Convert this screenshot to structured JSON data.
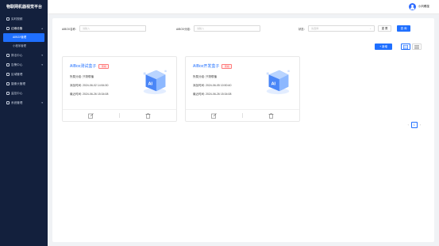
{
  "app": {
    "title": "物联网机器视觉平台"
  },
  "sidebar": {
    "items": [
      {
        "label": "实时视频"
      },
      {
        "label": "边缘设备",
        "expanded": true
      },
      {
        "label": "AIBOX管理",
        "sub": true,
        "active": true
      },
      {
        "label": "小程序管理",
        "sub": true
      },
      {
        "label": "算法中心"
      },
      {
        "label": "告警中心"
      },
      {
        "label": "区域管理"
      },
      {
        "label": "摄像头管理"
      },
      {
        "label": "监控中心"
      },
      {
        "label": "系统管理"
      }
    ]
  },
  "header": {
    "username": "小风螺旋"
  },
  "filters": {
    "name_label": "AIBOX名称：",
    "name_placeholder": "请输入",
    "group_label": "AIBOX分组：",
    "group_placeholder": "请输入",
    "status_label": "状态：",
    "status_placeholder": "请选择"
  },
  "buttons": {
    "reset": "重 置",
    "search": "查 询",
    "add": "+ 新增"
  },
  "cards": [
    {
      "title": "AIBox测试盒子",
      "status": "离线",
      "group": "所属分组: 只物联播",
      "added": "添加时间: 2024-06-02 14:54:30",
      "updated": "最近时间: 2024-06-26 15:34:08"
    },
    {
      "title": "AIBox开发盒子",
      "status": "离线",
      "group": "所属分组: 只物联播",
      "added": "添加时间: 2024-06-05 10:50:40",
      "updated": "最近时间: 2024-06-26 15:34:08"
    }
  ],
  "pagination": {
    "prev": "‹",
    "current": "1",
    "next": "›"
  },
  "colors": {
    "primary": "#1f6fff",
    "sidebar": "#13203d",
    "danger": "#ff4d4f"
  }
}
